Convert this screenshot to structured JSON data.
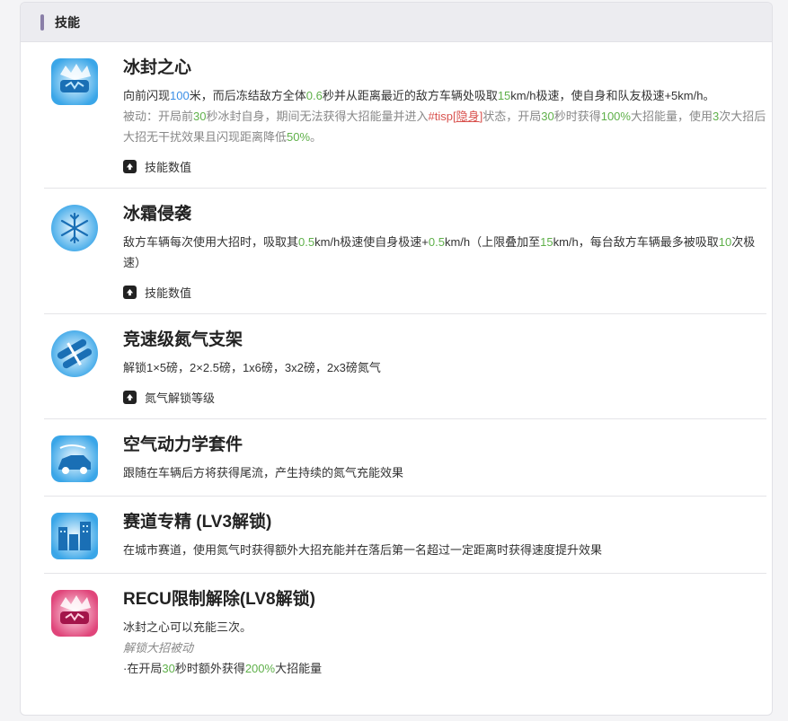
{
  "section": {
    "title": "技能"
  },
  "skills": [
    {
      "name": "冰封之心",
      "desc": [
        "向前闪现",
        "100",
        "米，而后冻结敌方全体",
        "0.6",
        "秒并从距离最近的敌方车辆处吸取",
        "15",
        "km/h极速，使自身和队友极速+5km/h。"
      ],
      "passive": [
        "被动：开局前",
        "30",
        "秒冰封自身，期间无法获得大招能量并进入",
        "#tisp[",
        "隐身",
        "]",
        "状态，开局",
        "30",
        "秒时获得",
        "100%",
        "大招能量，使用",
        "3",
        "次大招后大招无干扰效果且闪现距离降低",
        "50%",
        "。"
      ],
      "toggle": "技能数值",
      "icon": "frozen-heart-icon",
      "icon_color": "#3aa6e8"
    },
    {
      "name": "冰霜侵袭",
      "desc": [
        "敌方车辆每次使用大招时，吸取其",
        "0.5",
        "km/h极速使自身极速+",
        "0.5",
        "km/h（上限叠加至",
        "15",
        "km/h，每台敌方车辆最多被吸取",
        "10",
        "次极速）"
      ],
      "toggle": "技能数值",
      "icon": "snowflake-icon",
      "icon_color": "#3aa6e8"
    },
    {
      "name": "竞速级氮气支架",
      "desc": "解锁1×5磅，2×2.5磅，1x6磅，3x2磅，2x3磅氮气",
      "toggle": "氮气解锁等级",
      "icon": "nitro-tank-icon",
      "icon_color": "#3aa6e8"
    },
    {
      "name": "空气动力学套件",
      "desc": "跟随在车辆后方将获得尾流，产生持续的氮气充能效果",
      "icon": "car-wind-icon",
      "icon_color": "#3aa6e8"
    },
    {
      "name": "赛道专精 (LV3解锁)",
      "desc": "在城市赛道，使用氮气时获得额外大招充能并在落后第一名超过一定距离时获得速度提升效果",
      "icon": "city-track-icon",
      "icon_color": "#3aa6e8"
    },
    {
      "name": "RECU限制解除(LV8解锁)",
      "desc": "冰封之心可以充能三次。",
      "subtitle": "解锁大招被动",
      "extra": [
        "·在开局",
        "30",
        "秒时额外获得",
        "200%",
        "大招能量"
      ],
      "icon": "frozen-heart-pink-icon",
      "icon_color": "#e0457a"
    }
  ]
}
